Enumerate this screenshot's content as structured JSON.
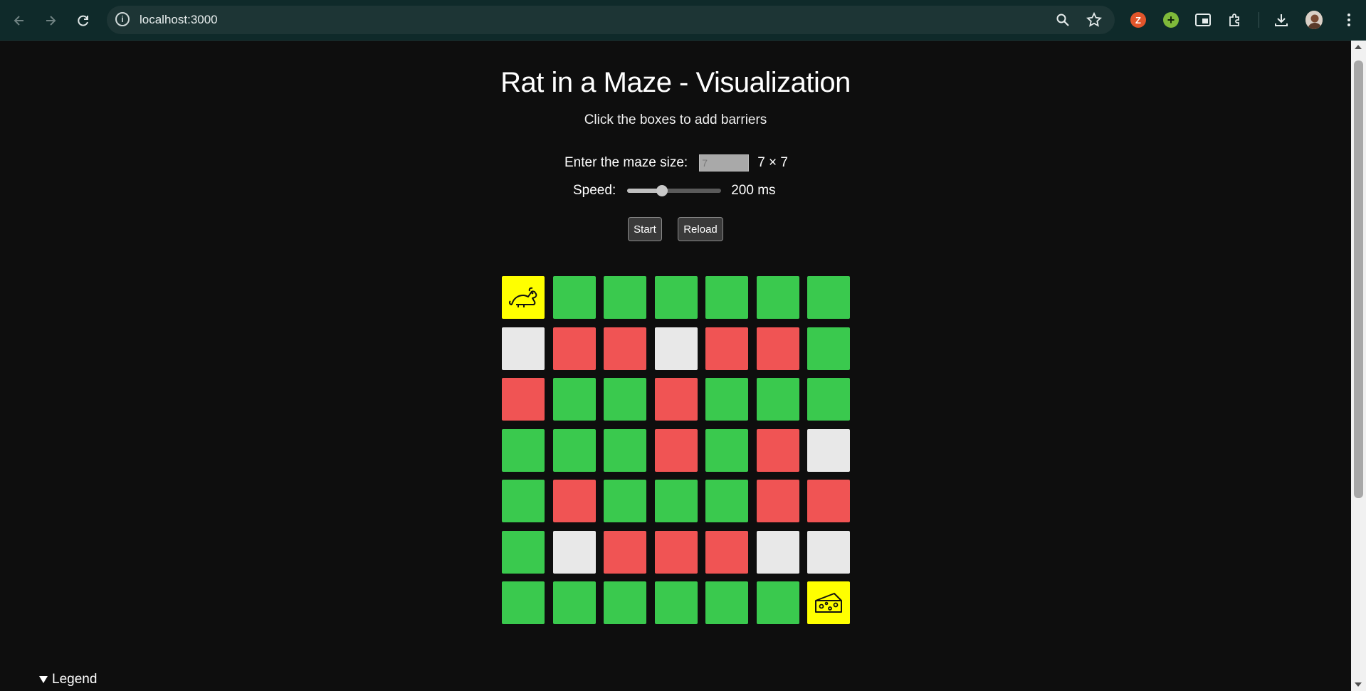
{
  "browser": {
    "url": "localhost:3000",
    "ext_z_label": "Z",
    "ext_plus_label": "+"
  },
  "header": {
    "title": "Rat in a Maze - Visualization",
    "subtitle": "Click the boxes to add barriers"
  },
  "controls": {
    "size_label": "Enter the maze size:",
    "size_value": "7",
    "size_readout": "7 × 7",
    "speed_label": "Speed:",
    "speed_value_ms": 200,
    "speed_fraction": 0.37,
    "speed_readout": "200 ms",
    "start_label": "Start",
    "reload_label": "Reload"
  },
  "grid": {
    "rows": 7,
    "cols": 7,
    "cells": [
      [
        "rat",
        "path",
        "path",
        "path",
        "path",
        "path",
        "path"
      ],
      [
        "wall",
        "dead",
        "dead",
        "wall",
        "dead",
        "dead",
        "path"
      ],
      [
        "dead",
        "path",
        "path",
        "dead",
        "path",
        "path",
        "path"
      ],
      [
        "path",
        "path",
        "path",
        "dead",
        "path",
        "dead",
        "wall"
      ],
      [
        "path",
        "dead",
        "path",
        "path",
        "path",
        "dead",
        "dead"
      ],
      [
        "path",
        "wall",
        "dead",
        "dead",
        "dead",
        "wall",
        "wall"
      ],
      [
        "path",
        "path",
        "path",
        "path",
        "path",
        "path",
        "cheese"
      ]
    ],
    "colors": {
      "path": "#3ac94e",
      "dead": "#f05454",
      "wall": "#e8e8e8",
      "endpoint": "#ffff00"
    },
    "icons": {
      "rat": "rat-icon",
      "cheese": "cheese-icon"
    }
  },
  "legend": {
    "label": "Legend"
  }
}
